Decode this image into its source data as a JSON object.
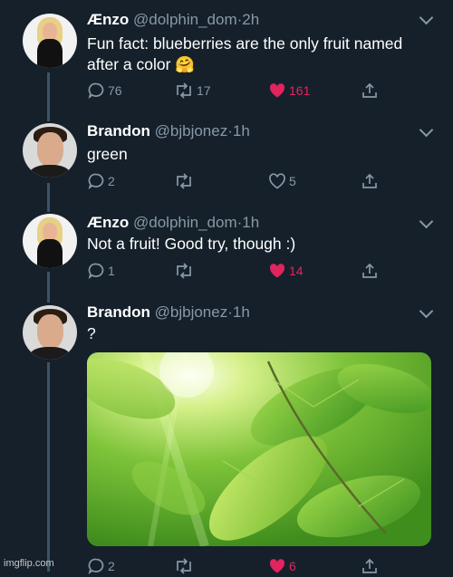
{
  "tweets": [
    {
      "name": "Ænzo",
      "handle": "@dolphin_dom",
      "dot": "·",
      "time": "2h",
      "line1": "Fun fact: blueberries are the only fruit named",
      "line2": "after a color 🤗",
      "replies": "76",
      "retweets": "17",
      "likes": "161",
      "avatar": "woman-blonde-hair-avatar"
    },
    {
      "name": "Brandon",
      "handle": "@bjbjonez",
      "dot": "·",
      "time": "1h",
      "line1": "green",
      "replies": "2",
      "retweets": "",
      "likes": "5",
      "avatar": "young-man-avatar"
    },
    {
      "name": "Ænzo",
      "handle": "@dolphin_dom",
      "dot": "·",
      "time": "1h",
      "line1": "Not a fruit! Good try, though :)",
      "replies": "1",
      "retweets": "",
      "likes": "14",
      "avatar": "woman-blonde-hair-avatar"
    },
    {
      "name": "Brandon",
      "handle": "@bjbjonez",
      "dot": "·",
      "time": "1h",
      "line1": "?",
      "replies": "2",
      "retweets": "",
      "likes": "6",
      "avatar": "young-man-avatar",
      "media": "sunlit-green-leaves-photo"
    }
  ],
  "colors": {
    "background": "#15202b",
    "muted": "#8899a6",
    "like": "#e0245e",
    "thread_line": "#3d5466"
  },
  "watermark": "imgflip.com"
}
